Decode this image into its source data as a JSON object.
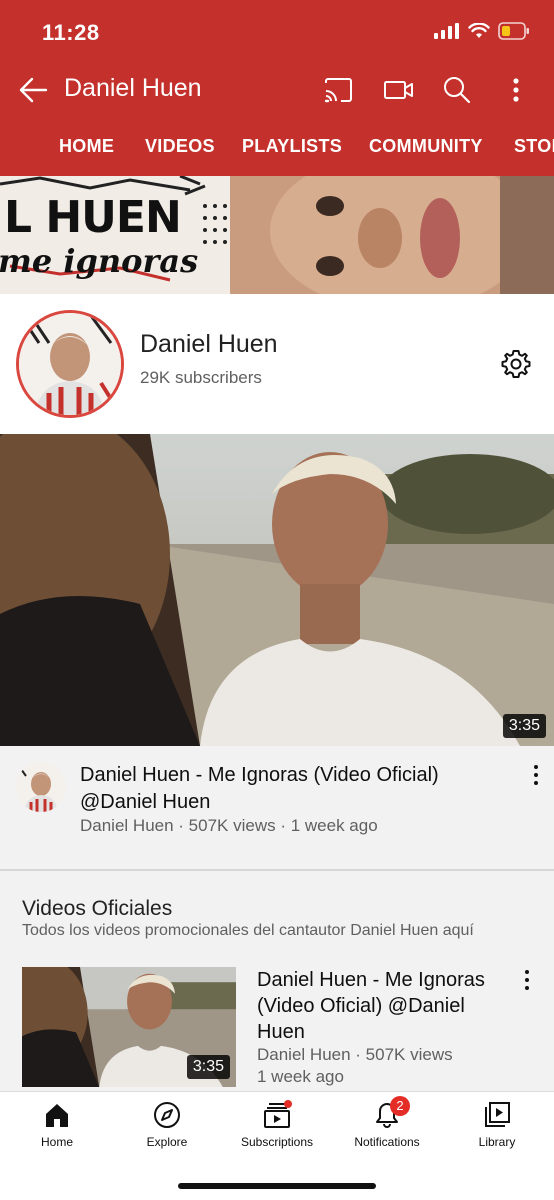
{
  "status_bar": {
    "time": "11:28",
    "icons": [
      "signal-icon",
      "wifi-icon",
      "battery-icon"
    ]
  },
  "app_bar": {
    "title": "Daniel Huen",
    "icons": [
      "back-arrow-icon",
      "cast-icon",
      "video-camera-icon",
      "search-icon",
      "more-vertical-icon"
    ],
    "accent": "#c4302b"
  },
  "tabs": [
    "HOME",
    "VIDEOS",
    "PLAYLISTS",
    "COMMUNITY",
    "STORE"
  ],
  "banner": {
    "artist_text": "L HUEN",
    "song_text": "me ignoras"
  },
  "channel": {
    "name": "Daniel Huen",
    "subscribers": "29K subscribers"
  },
  "featured_video": {
    "duration": "3:35",
    "title": "Daniel Huen - Me Ignoras (Video Oficial) @Daniel Huen",
    "meta": "Daniel Huen · 507K views · 1 week ago"
  },
  "section": {
    "title": "Videos Oficiales",
    "subtitle": "Todos los videos promocionales del cantautor Daniel Huen aquí",
    "items": [
      {
        "duration": "3:35",
        "title": "Daniel Huen - Me Ignoras (Video Oficial) @Daniel Huen",
        "channel_views": "Daniel Huen · 507K views",
        "age": "1 week ago"
      }
    ]
  },
  "bottom_nav": [
    {
      "label": "Home",
      "icon": "home-icon"
    },
    {
      "label": "Explore",
      "icon": "compass-icon"
    },
    {
      "label": "Subscriptions",
      "icon": "subscriptions-icon"
    },
    {
      "label": "Notifications",
      "icon": "bell-icon",
      "badge": "2"
    },
    {
      "label": "Library",
      "icon": "library-icon"
    }
  ]
}
